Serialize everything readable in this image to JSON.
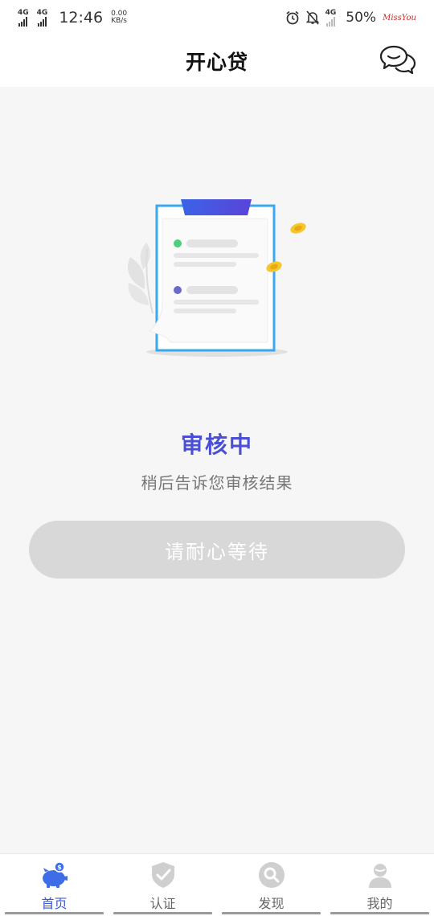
{
  "status_bar": {
    "net1": "4G",
    "net2": "4G",
    "time": "12:46",
    "speed_value": "0.00",
    "speed_unit": "KB/s",
    "net3": "4G",
    "battery": "50%",
    "carrier_text": "MissYou"
  },
  "header": {
    "title": "开心贷",
    "chat_icon": "chat-bubbles-icon"
  },
  "main": {
    "illustration_icon": "clipboard-document-icon",
    "status_title": "审核中",
    "status_subtitle": "稍后告诉您审核结果",
    "wait_button_label": "请耐心等待"
  },
  "colors": {
    "accent": "#4a4fd4",
    "nav_active": "#3a5ad8",
    "button_disabled": "#d8d8d8"
  },
  "bottom_nav": {
    "items": [
      {
        "label": "首页",
        "icon": "piggy-bank-icon",
        "active": true
      },
      {
        "label": "认证",
        "icon": "shield-check-icon",
        "active": false
      },
      {
        "label": "发现",
        "icon": "search-discover-icon",
        "active": false
      },
      {
        "label": "我的",
        "icon": "user-profile-icon",
        "active": false
      }
    ]
  }
}
